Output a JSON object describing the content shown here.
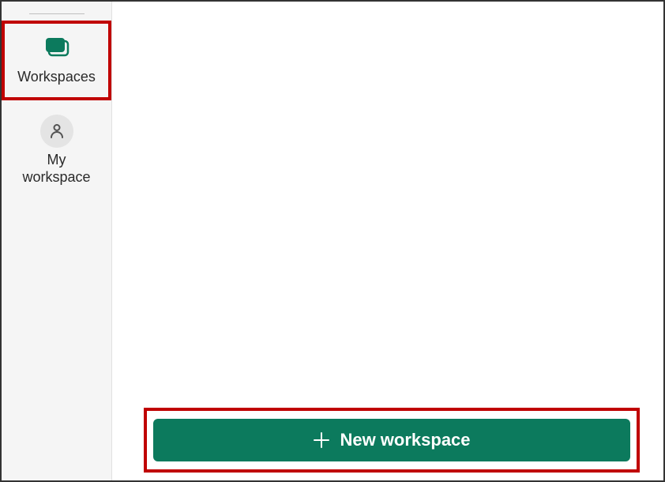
{
  "sidebar": {
    "items": [
      {
        "label": "Workspaces",
        "icon": "workspaces-icon"
      },
      {
        "label": "My\nworkspace",
        "icon": "person-icon"
      }
    ]
  },
  "main": {
    "new_workspace_button": "New workspace"
  },
  "colors": {
    "accent": "#0c7a5d",
    "highlight": "#c00000",
    "sidebar_bg": "#f5f5f5"
  }
}
